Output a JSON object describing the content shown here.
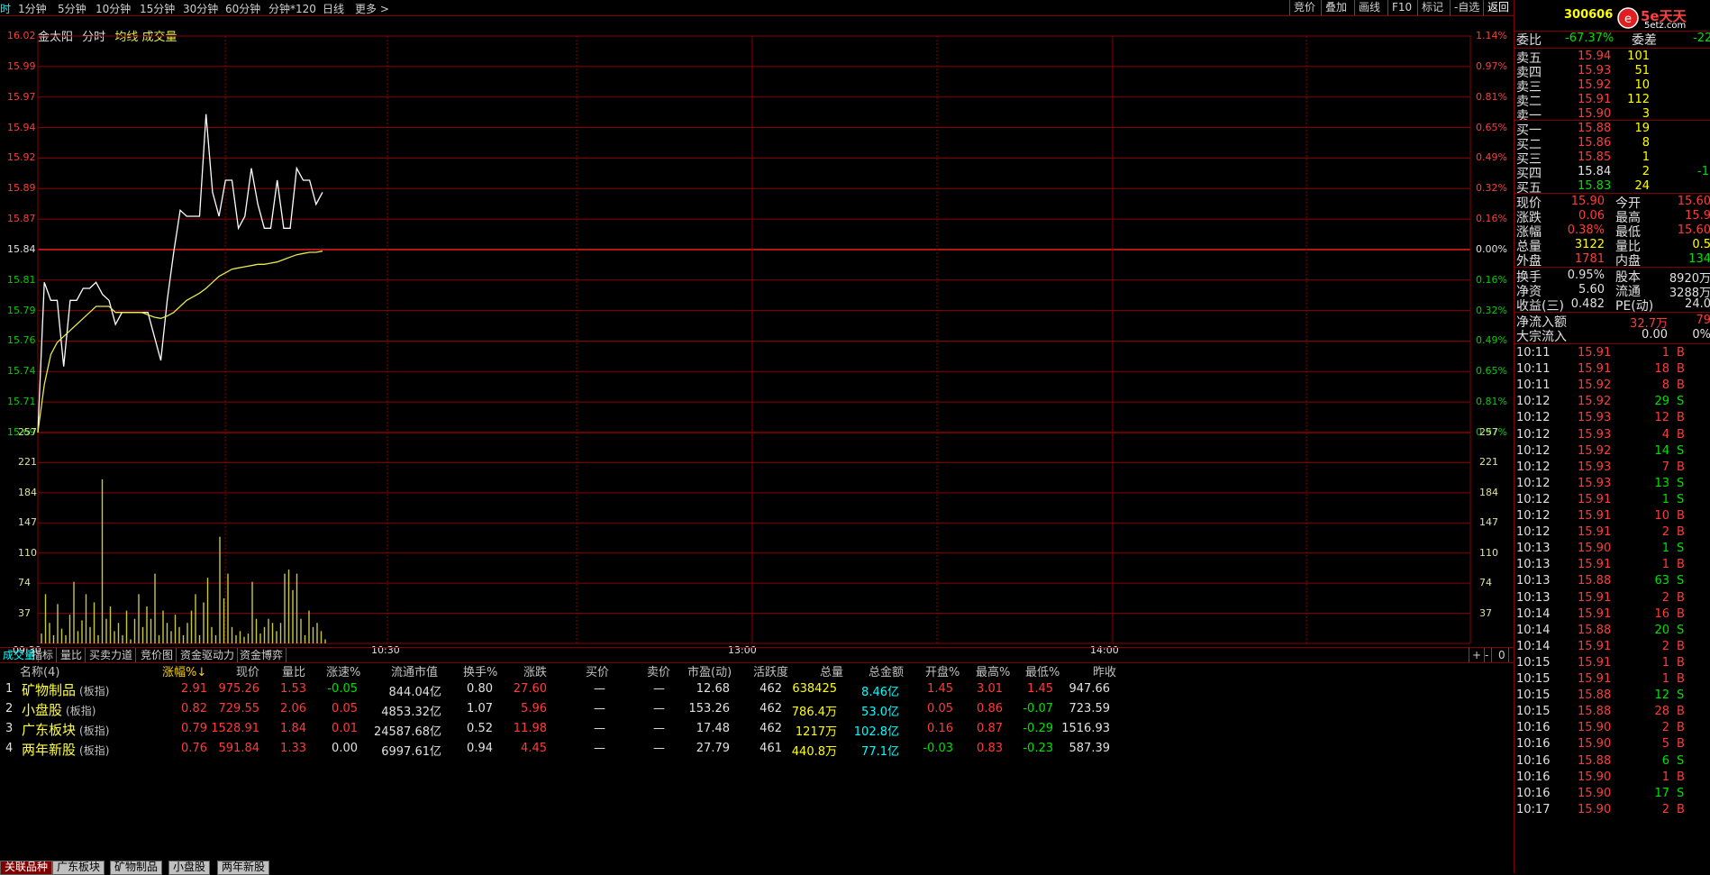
{
  "toolbar": {
    "tabs": [
      "时",
      "1分钟",
      "5分钟",
      "10分钟",
      "15分钟",
      "30分钟",
      "60分钟",
      "分钟*120",
      "日线",
      "更多 >"
    ],
    "right": [
      "竞价",
      "叠加",
      "画线",
      "F10",
      "标记",
      "-自选",
      "返回"
    ]
  },
  "chart": {
    "header": {
      "stock": "金太阳",
      "mode": "分时",
      "avg": "均线",
      "vol": "成交量"
    },
    "price_labels": [
      "16.02",
      "15.99",
      "15.97",
      "15.94",
      "15.92",
      "15.89",
      "15.87",
      "15.84",
      "15.81",
      "15.79",
      "15.76",
      "15.74",
      "15.71",
      "15.69"
    ],
    "pct_labels": [
      "1.14%",
      "0.97%",
      "0.81%",
      "0.65%",
      "0.49%",
      "0.32%",
      "0.16%",
      "0.00%",
      "0.16%",
      "0.32%",
      "0.49%",
      "0.65%",
      "0.81%",
      "0.97%"
    ],
    "vol_labels": [
      "257",
      "221",
      "184",
      "147",
      "110",
      "74",
      "37"
    ],
    "time_labels": [
      "09:30",
      "10:30",
      "13:00",
      "14:00"
    ],
    "colors": {
      "up": "#ff3b3b",
      "down": "#00d000",
      "grid": "#8b0000",
      "price": "#ffffff",
      "avg": "#e8e850",
      "vol": "#c8c840"
    }
  },
  "chart_data": {
    "type": "line",
    "title": "金太阳 分时",
    "ylim": [
      15.69,
      16.02
    ],
    "base_price": 15.84,
    "series": [
      {
        "name": "分时",
        "values": [
          15.69,
          15.815,
          15.8,
          15.8,
          15.745,
          15.8,
          15.8,
          15.81,
          15.81,
          15.815,
          15.805,
          15.8,
          15.78,
          15.79,
          15.79,
          15.79,
          15.79,
          15.79,
          15.77,
          15.75,
          15.8,
          15.84,
          15.875,
          15.87,
          15.87,
          15.87,
          15.955,
          15.89,
          15.87,
          15.9,
          15.9,
          15.86,
          15.87,
          15.91,
          15.88,
          15.86,
          15.86,
          15.9,
          15.86,
          15.86,
          15.91,
          15.9,
          15.9,
          15.88,
          15.89
        ]
      },
      {
        "name": "均线",
        "values": [
          15.69,
          15.73,
          15.755,
          15.765,
          15.77,
          15.775,
          15.78,
          15.785,
          15.79,
          15.795,
          15.795,
          15.795,
          15.79,
          15.79,
          15.79,
          15.79,
          15.79,
          15.788,
          15.786,
          15.785,
          15.787,
          15.79,
          15.795,
          15.8,
          15.803,
          15.806,
          15.81,
          15.815,
          15.82,
          15.823,
          15.826,
          15.827,
          15.828,
          15.829,
          15.83,
          15.83,
          15.831,
          15.832,
          15.834,
          15.836,
          15.838,
          15.839,
          15.84,
          15.84,
          15.841
        ]
      }
    ],
    "volume": {
      "ylim": [
        0,
        257
      ],
      "values": [
        12,
        60,
        25,
        10,
        48,
        18,
        10,
        35,
        75,
        15,
        28,
        60,
        20,
        50,
        10,
        200,
        30,
        45,
        15,
        25,
        10,
        40,
        5,
        30,
        60,
        20,
        45,
        30,
        85,
        10,
        40,
        25,
        15,
        35,
        20,
        10,
        25,
        40,
        60,
        10,
        50,
        80,
        20,
        10,
        130,
        55,
        85,
        20,
        10,
        15,
        8,
        12,
        75,
        30,
        12,
        20,
        30,
        25,
        15,
        25,
        85,
        90,
        65,
        85,
        30,
        10,
        40,
        20,
        25,
        15,
        5
      ]
    }
  },
  "subtabs": [
    "成交量",
    "指标",
    "量比",
    "买卖力道",
    "竞价图",
    "资金驱动力",
    "资金博弈"
  ],
  "subtab_right": [
    "+",
    "-",
    "0"
  ],
  "table": {
    "headers": [
      "名称(4)",
      "涨幅%↓",
      "现价",
      "量比",
      "涨速%",
      "流通市值",
      "换手%",
      "涨跌",
      "买价",
      "卖价",
      "市盈(动)",
      "活跃度",
      "总量",
      "总金额",
      "开盘%",
      "最高%",
      "最低%",
      "昨收"
    ],
    "rows": [
      {
        "no": "1",
        "name": "矿物制品",
        "tag": "(板指)",
        "chg": "2.91",
        "price": "975.26",
        "lb": "1.53",
        "speed": "-0.05",
        "mcap": "844.04亿",
        "turn": "0.80",
        "diff": "27.60",
        "bid": "—",
        "ask": "—",
        "pe": "12.68",
        "act": "462",
        "vol": "638425",
        "amt": "8.46亿",
        "open": "1.45",
        "high": "3.01",
        "low": "1.45",
        "prev": "947.66"
      },
      {
        "no": "2",
        "name": "小盘股",
        "tag": "(板指)",
        "chg": "0.82",
        "price": "729.55",
        "lb": "2.06",
        "speed": "0.05",
        "mcap": "4853.32亿",
        "turn": "1.07",
        "diff": "5.96",
        "bid": "—",
        "ask": "—",
        "pe": "153.26",
        "act": "462",
        "vol": "786.4万",
        "amt": "53.0亿",
        "open": "0.05",
        "high": "0.86",
        "low": "-0.07",
        "prev": "723.59"
      },
      {
        "no": "3",
        "name": "广东板块",
        "tag": "(板指)",
        "chg": "0.79",
        "price": "1528.91",
        "lb": "1.84",
        "speed": "0.01",
        "mcap": "24587.68亿",
        "turn": "0.52",
        "diff": "11.98",
        "bid": "—",
        "ask": "—",
        "pe": "17.48",
        "act": "462",
        "vol": "1217万",
        "amt": "102.8亿",
        "open": "0.16",
        "high": "0.87",
        "low": "-0.29",
        "prev": "1516.93"
      },
      {
        "no": "4",
        "name": "两年新股",
        "tag": "(板指)",
        "chg": "0.76",
        "price": "591.84",
        "lb": "1.33",
        "speed": "0.00",
        "mcap": "6997.61亿",
        "turn": "0.94",
        "diff": "4.45",
        "bid": "—",
        "ask": "—",
        "pe": "27.79",
        "act": "461",
        "vol": "440.8万",
        "amt": "77.1亿",
        "open": "-0.03",
        "high": "0.83",
        "low": "-0.23",
        "prev": "587.39"
      }
    ]
  },
  "sheet_tabs": [
    "关联品种",
    "广东板块",
    "矿物制品",
    "小盘股",
    "两年新股"
  ],
  "quote": {
    "code": "300606",
    "logo": "5e天天",
    "logo_sub": "5etz.com",
    "ratio_label": "委比",
    "ratio": "-67.37%",
    "diff_label": "委差",
    "diff": "-22",
    "sells": [
      {
        "l": "卖五",
        "p": "15.94",
        "v": "101"
      },
      {
        "l": "卖四",
        "p": "15.93",
        "v": "51"
      },
      {
        "l": "卖三",
        "p": "15.92",
        "v": "10"
      },
      {
        "l": "卖二",
        "p": "15.91",
        "v": "112"
      },
      {
        "l": "卖一",
        "p": "15.90",
        "v": "3"
      }
    ],
    "buys": [
      {
        "l": "买一",
        "p": "15.88",
        "v": "19",
        "x": ""
      },
      {
        "l": "买二",
        "p": "15.86",
        "v": "8",
        "x": ""
      },
      {
        "l": "买三",
        "p": "15.85",
        "v": "1",
        "x": ""
      },
      {
        "l": "买四",
        "p": "15.84",
        "v": "2",
        "x": "-1"
      },
      {
        "l": "买五",
        "p": "15.83",
        "v": "24",
        "x": ""
      }
    ],
    "stats": [
      {
        "l": "现价",
        "v": "15.90",
        "l2": "今开",
        "v2": "15.60"
      },
      {
        "l": "涨跌",
        "v": "0.06",
        "l2": "最高",
        "v2": "15.9"
      },
      {
        "l": "涨幅",
        "v": "0.38%",
        "l2": "最低",
        "v2": "15.60"
      },
      {
        "l": "总量",
        "v": "3122",
        "l2": "量比",
        "v2": "0.5"
      },
      {
        "l": "外盘",
        "v": "1781",
        "l2": "内盘",
        "v2": "134"
      }
    ],
    "stats2": [
      {
        "l": "换手",
        "v": "0.95%",
        "l2": "股本",
        "v2": "8920万"
      },
      {
        "l": "净资",
        "v": "5.60",
        "l2": "流通",
        "v2": "3288万"
      },
      {
        "l": "收益(三)",
        "v": "0.482",
        "l2": "PE(动)",
        "v2": "24.0"
      }
    ],
    "flow": [
      {
        "l": "净流入额",
        "v": "32.7万",
        "v2": "79"
      },
      {
        "l": "大宗流入",
        "v": "0.00",
        "v2": "0%"
      }
    ],
    "ticks": [
      {
        "t": "10:11",
        "p": "15.91",
        "v": "1",
        "s": "B"
      },
      {
        "t": "10:11",
        "p": "15.91",
        "v": "18",
        "s": "B"
      },
      {
        "t": "10:11",
        "p": "15.92",
        "v": "8",
        "s": "B"
      },
      {
        "t": "10:12",
        "p": "15.92",
        "v": "29",
        "s": "S"
      },
      {
        "t": "10:12",
        "p": "15.93",
        "v": "12",
        "s": "B"
      },
      {
        "t": "10:12",
        "p": "15.93",
        "v": "4",
        "s": "B"
      },
      {
        "t": "10:12",
        "p": "15.92",
        "v": "14",
        "s": "S"
      },
      {
        "t": "10:12",
        "p": "15.93",
        "v": "7",
        "s": "B"
      },
      {
        "t": "10:12",
        "p": "15.93",
        "v": "13",
        "s": "S"
      },
      {
        "t": "10:12",
        "p": "15.91",
        "v": "1",
        "s": "S"
      },
      {
        "t": "10:12",
        "p": "15.91",
        "v": "10",
        "s": "B"
      },
      {
        "t": "10:12",
        "p": "15.91",
        "v": "2",
        "s": "B"
      },
      {
        "t": "10:13",
        "p": "15.90",
        "v": "1",
        "s": "S"
      },
      {
        "t": "10:13",
        "p": "15.91",
        "v": "1",
        "s": "B"
      },
      {
        "t": "10:13",
        "p": "15.88",
        "v": "63",
        "s": "S"
      },
      {
        "t": "10:13",
        "p": "15.91",
        "v": "2",
        "s": "B"
      },
      {
        "t": "10:14",
        "p": "15.91",
        "v": "16",
        "s": "B"
      },
      {
        "t": "10:14",
        "p": "15.88",
        "v": "20",
        "s": "S"
      },
      {
        "t": "10:14",
        "p": "15.91",
        "v": "2",
        "s": "B"
      },
      {
        "t": "10:15",
        "p": "15.91",
        "v": "1",
        "s": "B"
      },
      {
        "t": "10:15",
        "p": "15.91",
        "v": "1",
        "s": "B"
      },
      {
        "t": "10:15",
        "p": "15.88",
        "v": "12",
        "s": "S"
      },
      {
        "t": "10:15",
        "p": "15.88",
        "v": "28",
        "s": "B"
      },
      {
        "t": "10:16",
        "p": "15.90",
        "v": "2",
        "s": "B"
      },
      {
        "t": "10:16",
        "p": "15.90",
        "v": "5",
        "s": "B"
      },
      {
        "t": "10:16",
        "p": "15.88",
        "v": "6",
        "s": "S"
      },
      {
        "t": "10:16",
        "p": "15.90",
        "v": "1",
        "s": "B"
      },
      {
        "t": "10:16",
        "p": "15.90",
        "v": "17",
        "s": "S"
      },
      {
        "t": "10:17",
        "p": "15.90",
        "v": "2",
        "s": "B"
      }
    ]
  }
}
